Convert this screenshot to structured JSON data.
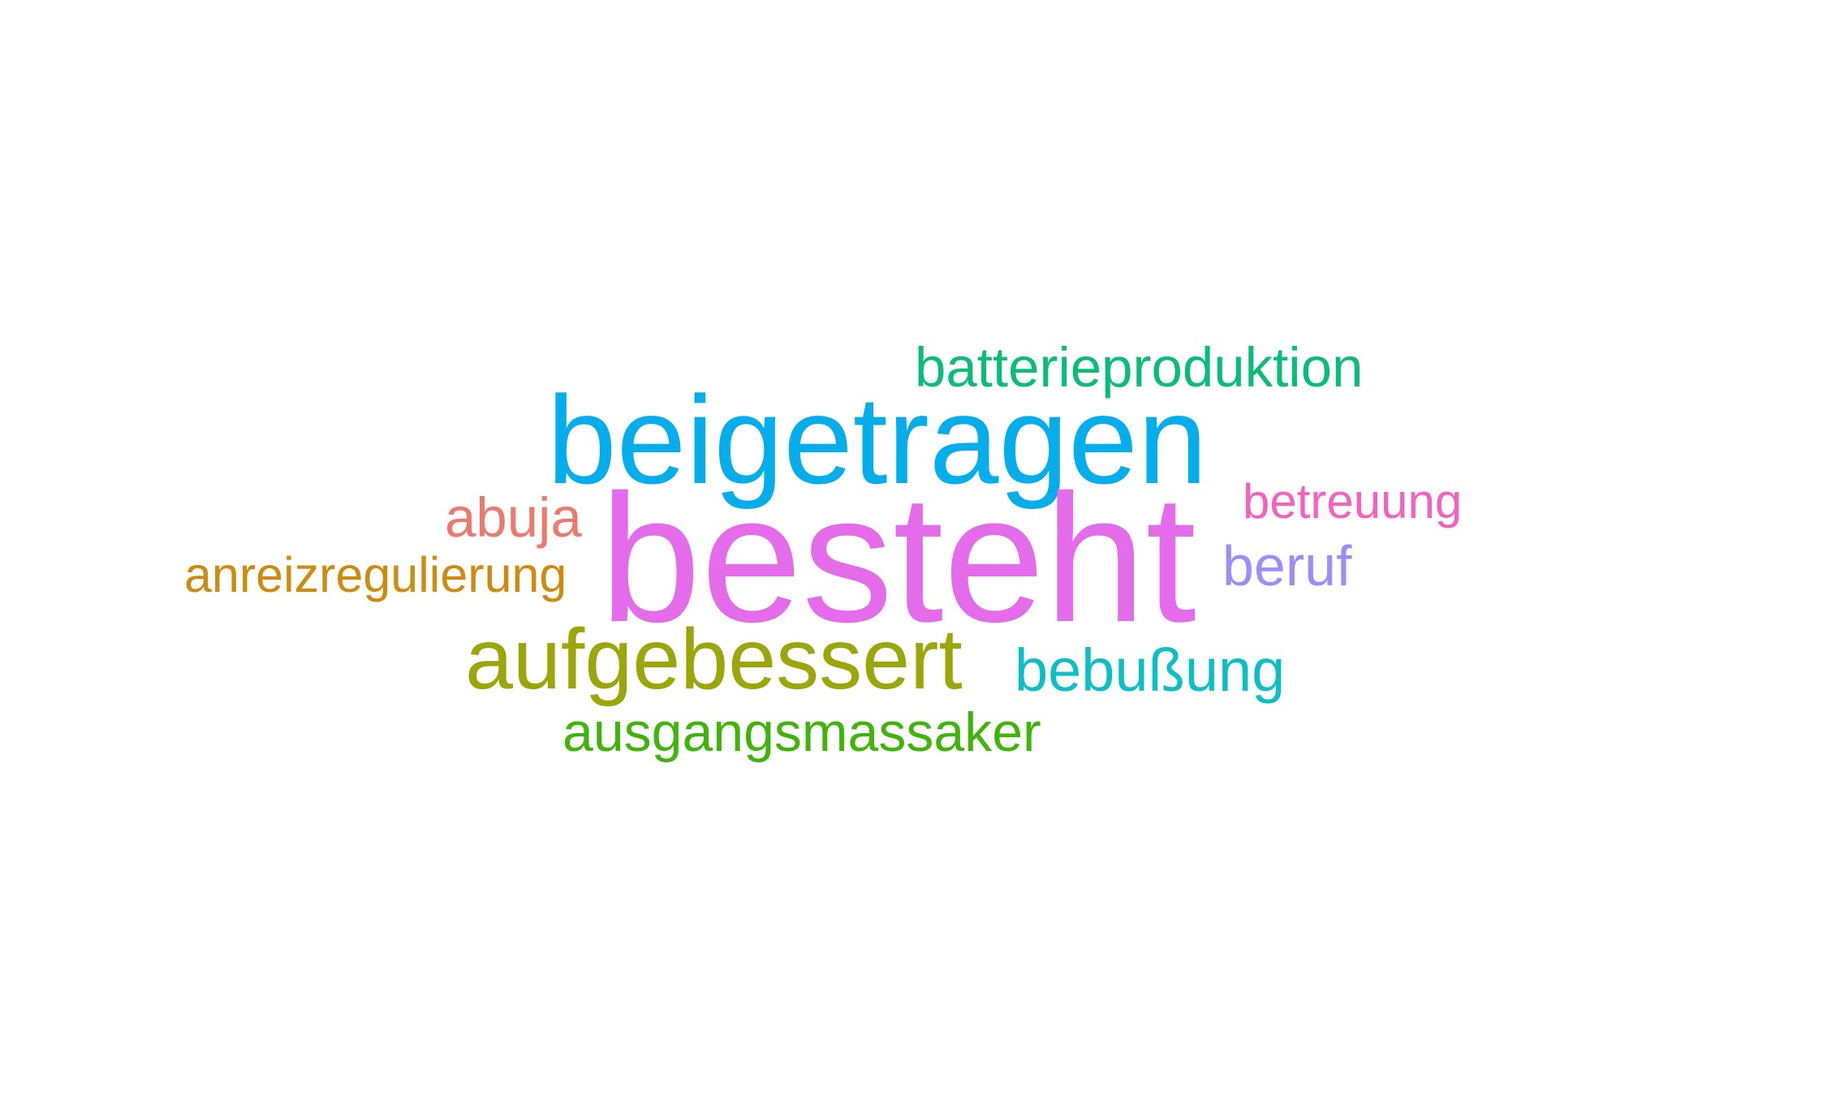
{
  "words": {
    "besteht": {
      "text": "besteht",
      "color": "#E46CEB"
    },
    "beigetragen": {
      "text": "beigetragen",
      "color": "#06ADEB"
    },
    "aufgebessert": {
      "text": "aufgebessert",
      "color": "#9AA60A"
    },
    "batterieproduktion": {
      "text": "batterieproduktion",
      "color": "#09BD78"
    },
    "abuja": {
      "text": "abuja",
      "color": "#EC7A6F"
    },
    "anreizregulierung": {
      "text": "anreizregulierung",
      "color": "#CD8C10"
    },
    "betreuung": {
      "text": "betreuung",
      "color": "#F363BE"
    },
    "beruf": {
      "text": "beruf",
      "color": "#9A8FF8"
    },
    "bebussung": {
      "text": "bebußung",
      "color": "#0CBFC4"
    },
    "ausgangsmassaker": {
      "text": "ausgangsmassaker",
      "color": "#41B40B"
    }
  }
}
